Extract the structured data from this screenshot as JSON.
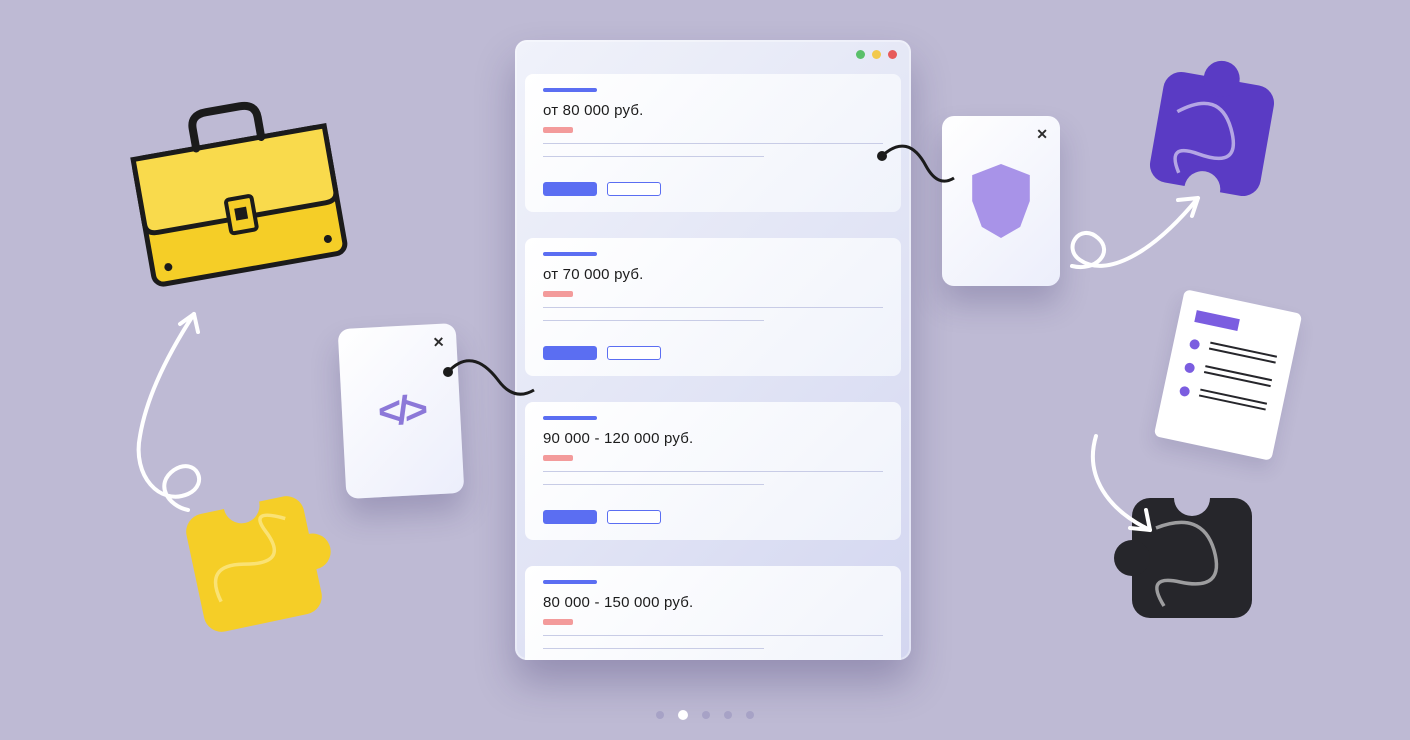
{
  "listings": [
    {
      "salary": "от 80 000 руб."
    },
    {
      "salary": "от 70 000 руб."
    },
    {
      "salary": "90 000 - 120 000 руб."
    },
    {
      "salary": "80 000 - 150 000 руб."
    }
  ],
  "popup_code_glyph": "</>",
  "popup_close_glyph": "✕",
  "pagination": {
    "count": 5,
    "active_index": 1
  },
  "colors": {
    "accent_blue": "#5B6EF2",
    "accent_purple": "#7B5DE0",
    "badge_pink": "#F39B9B",
    "briefcase_yellow": "#F5CE27"
  }
}
